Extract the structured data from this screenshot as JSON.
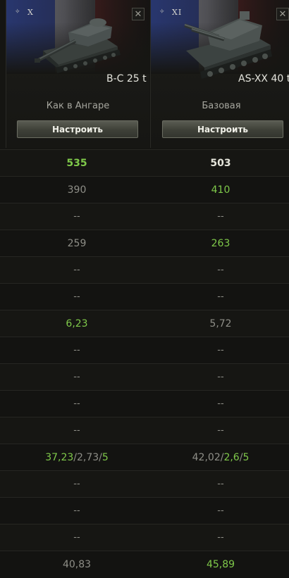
{
  "vehicles": [
    {
      "tier": "X",
      "name": "B-C 25 t",
      "config": "Как в Ангаре",
      "button": "Настроить",
      "nation_icon": "france-nation-icon"
    },
    {
      "tier": "XI",
      "name": "AS-XX 40 t",
      "config": "Базовая",
      "button": "Настроить",
      "nation_icon": "france-nation-icon"
    }
  ],
  "close_glyph": "✕",
  "rows": {
    "r0": {
      "a": "535",
      "b": "503"
    },
    "r1": {
      "a": "390",
      "b": "410"
    },
    "r2": {
      "a": "--",
      "b": "--"
    },
    "r3": {
      "a": "259",
      "b": "263"
    },
    "r4": {
      "a": "--",
      "b": "--"
    },
    "r5": {
      "a": "--",
      "b": "--"
    },
    "r6": {
      "a": "6,23",
      "b": "5,72"
    },
    "r7": {
      "a": "--",
      "b": "--"
    },
    "r8": {
      "a": "--",
      "b": "--"
    },
    "r9": {
      "a": "--",
      "b": "--"
    },
    "r10": {
      "a": "--",
      "b": "--"
    },
    "r11": {
      "a": {
        "p1": "37,23",
        "s1": "/",
        "p2": "2,73",
        "s2": "/",
        "p3": "5"
      },
      "b": {
        "p1": "42,02",
        "s1": "/",
        "p2": "2,6",
        "s2": "/",
        "p3": "5"
      }
    },
    "r12": {
      "a": "--",
      "b": "--"
    },
    "r13": {
      "a": "--",
      "b": "--"
    },
    "r14": {
      "a": "--",
      "b": "--"
    },
    "r15": {
      "a": "40,83",
      "b": "45,89"
    }
  },
  "colors": {
    "better": "#7fc94a",
    "neutral": "#8e8e87",
    "highlight": "#e6e6dc"
  }
}
